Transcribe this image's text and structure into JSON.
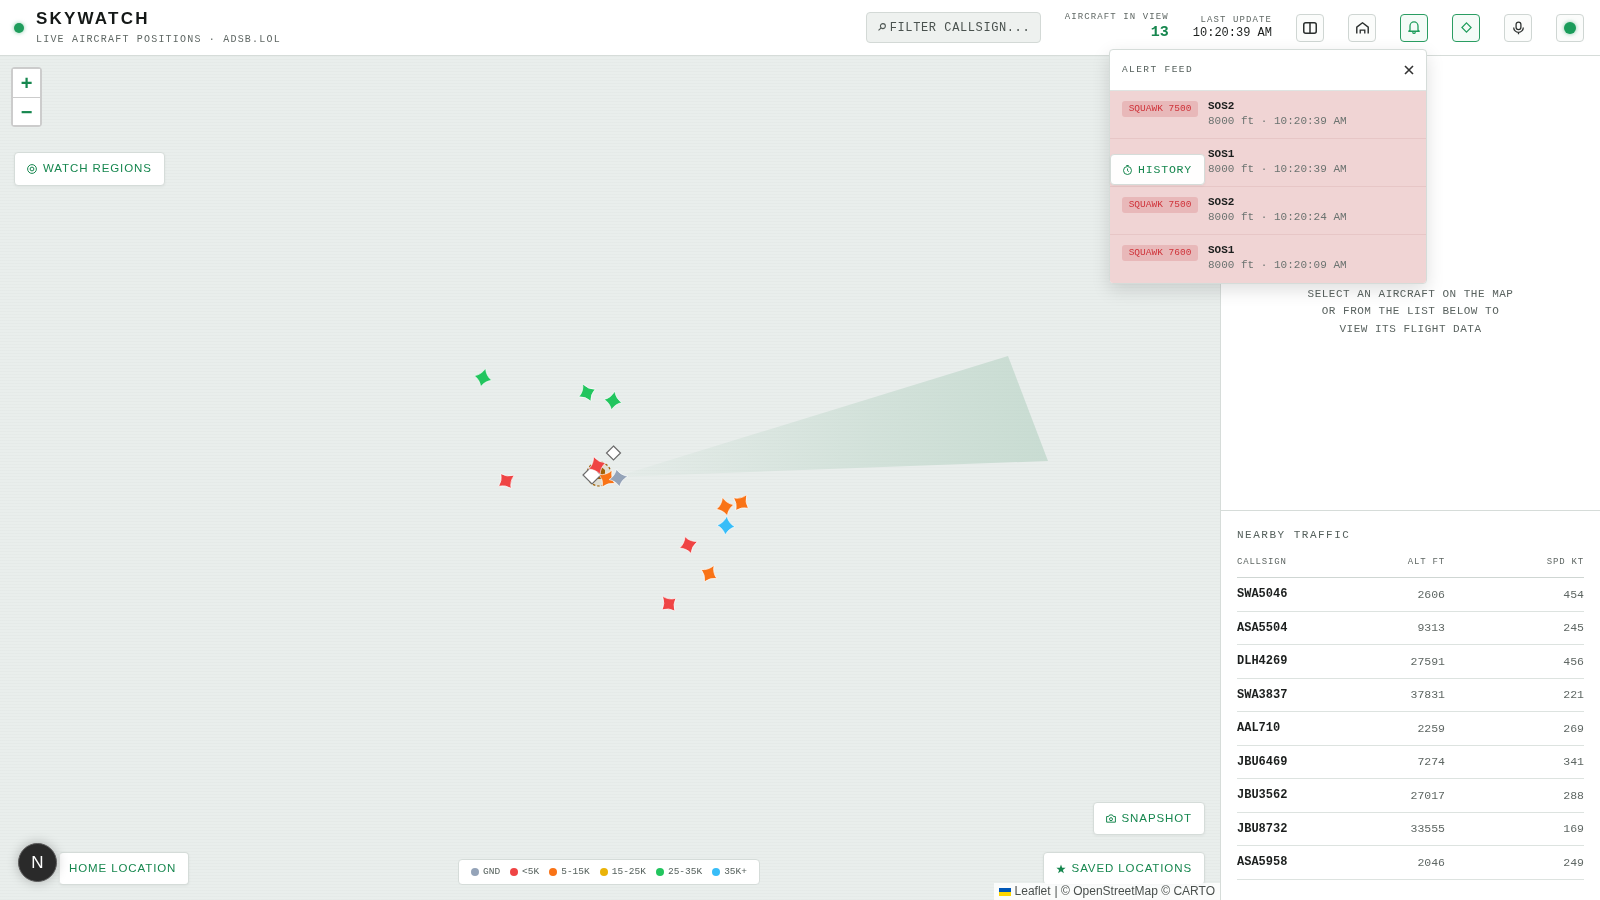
{
  "header": {
    "title": "SKYWATCH",
    "subtitle": "LIVE AIRCRAFT POSITIONS · ADSB.LOL",
    "filter": {
      "placeholder": "FILTER CALLSIGN..."
    },
    "stats": [
      {
        "kind": "count",
        "label": "AIRCRAFT IN VIEW",
        "value": "13"
      },
      {
        "kind": "time",
        "label": "LAST UPDATE",
        "value": "10:20:39 AM"
      }
    ],
    "tools": [
      {
        "kind": "panel",
        "on": false
      },
      {
        "kind": "house",
        "on": false
      },
      {
        "kind": "bell",
        "on": true
      },
      {
        "kind": "diamond",
        "on": true
      },
      {
        "kind": "mic",
        "on": false
      },
      {
        "kind": "status",
        "on": false
      }
    ]
  },
  "map": {
    "zoom": {
      "in": "+",
      "out": "−"
    },
    "controls": {
      "watch_regions": "WATCH REGIONS",
      "history": "HISTORY",
      "snapshot": "SNAPSHOT",
      "home_location": "HOME LOCATION",
      "saved_locations": "SAVED LOCATIONS"
    },
    "aircraft": [
      {
        "color": "#22c55e"
      },
      {
        "color": "#22c55e"
      },
      {
        "color": "#22c55e"
      },
      {
        "color": "#ef4444"
      },
      {
        "color": "#f97316"
      },
      {
        "color": "#94a3b8"
      },
      {
        "color": "#ef4444"
      },
      {
        "color": "#f97316"
      },
      {
        "color": "#f97316"
      },
      {
        "color": "#38bdf8"
      },
      {
        "color": "#ef4444"
      },
      {
        "color": "#f97316"
      },
      {
        "color": "#ef4444"
      }
    ],
    "legend": [
      {
        "label": "GND",
        "color": "#94a3b8"
      },
      {
        "label": "<5K",
        "color": "#ef4444"
      },
      {
        "label": "5-15K",
        "color": "#f97316"
      },
      {
        "label": "15-25K",
        "color": "#eab308"
      },
      {
        "label": "25-35K",
        "color": "#22c55e"
      },
      {
        "label": "35K+",
        "color": "#38bdf8"
      }
    ],
    "attribution": {
      "leaflet": "Leaflet",
      "credits": "| © OpenStreetMap © CARTO"
    }
  },
  "alert_feed": {
    "title": "ALERT FEED",
    "alerts": [
      {
        "badge": "SQUAWK 7500",
        "callsign": "SOS2",
        "detail": "8000 ft · 10:20:39 AM"
      },
      {
        "callsign": "SOS1",
        "detail": "8000 ft · 10:20:39 AM"
      },
      {
        "badge": "SQUAWK 7500",
        "callsign": "SOS2",
        "detail": "8000 ft · 10:20:24 AM"
      },
      {
        "badge": "SQUAWK 7600",
        "callsign": "SOS1",
        "detail": "8000 ft · 10:20:09 AM"
      }
    ]
  },
  "details_panel": {
    "hint": "SELECT AN AIRCRAFT ON THE MAP OR FROM THE LIST BELOW TO VIEW ITS FLIGHT DATA"
  },
  "nearby_traffic": {
    "title": "NEARBY TRAFFIC",
    "columns": [
      "CALLSIGN",
      "ALT FT",
      "SPD KT"
    ],
    "rows": [
      [
        "SWA5046",
        "2606",
        "454"
      ],
      [
        "ASA5504",
        "9313",
        "245"
      ],
      [
        "DLH4269",
        "27591",
        "456"
      ],
      [
        "SWA3837",
        "37831",
        "221"
      ],
      [
        "AAL710",
        "2259",
        "269"
      ],
      [
        "JBU6469",
        "7274",
        "341"
      ],
      [
        "JBU3562",
        "27017",
        "288"
      ],
      [
        "JBU8732",
        "33555",
        "169"
      ],
      [
        "ASA5958",
        "2046",
        "249"
      ]
    ]
  },
  "dev_badge": {
    "label": "N"
  }
}
